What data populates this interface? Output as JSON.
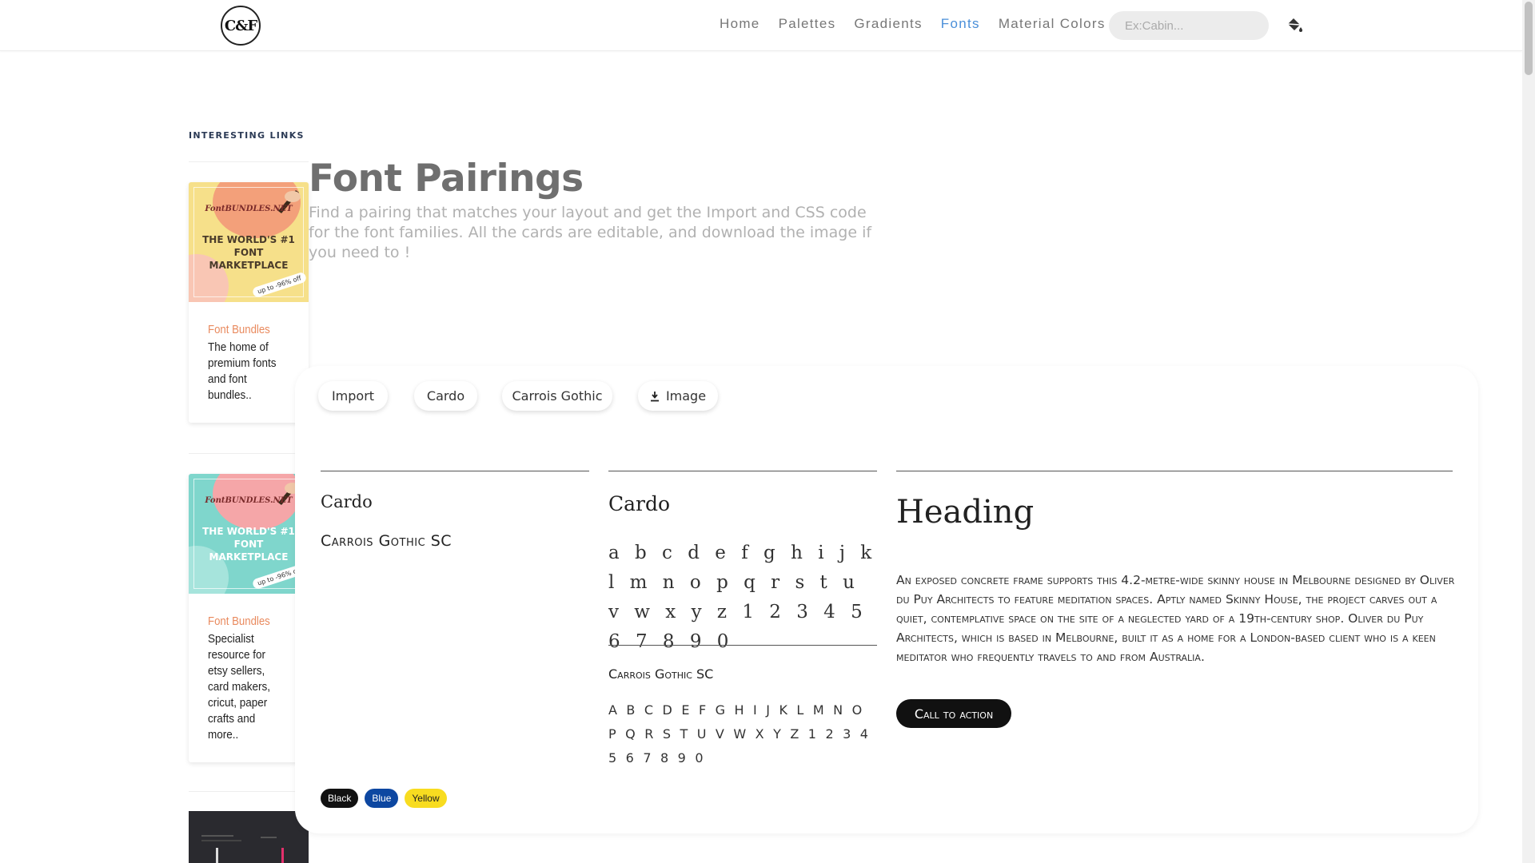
{
  "brand": {
    "logo_text": "C&F"
  },
  "nav": {
    "items": [
      {
        "label": "Home",
        "active": false
      },
      {
        "label": "Palettes",
        "active": false
      },
      {
        "label": "Gradients",
        "active": false
      },
      {
        "label": "Fonts",
        "active": true
      },
      {
        "label": "Material Colors",
        "active": false
      }
    ],
    "search_placeholder": "Ex:Cabin..."
  },
  "sidebar": {
    "title": "INTERESTING LINKS",
    "ads": [
      {
        "brand": "FontBUNDLES.NET",
        "headline": "THE WORLD'S #1 FONT MARKETPLACE",
        "tag": "up to -96% off",
        "link": "Font Bundles",
        "description": "The home of premium fonts and font bundles..",
        "bg": "#f6e08a",
        "accent": "#f3a07a"
      },
      {
        "brand": "FontBUNDLES.NET",
        "headline": "THE WORLD'S #1 FONT MARKETPLACE",
        "tag": "up to -96% off",
        "link": "Font Bundles",
        "description": "Specialist resource for etsy sellers, card makers, cricut, paper crafts and more..",
        "bg": "#7fd6cc",
        "accent": "#f5a6a8"
      }
    ]
  },
  "hero": {
    "title": "Font Pairings",
    "subtitle": "Find a pairing that matches your layout and get the Import and CSS code for the font families. All the cards are editable, and download the image if you need to !"
  },
  "card": {
    "buttons": {
      "import": "Import",
      "font1": "Cardo",
      "font2": "Carrois Gothic",
      "image": "Image"
    },
    "col1": {
      "font1": "Cardo",
      "font2": "Carrois Gothic SC"
    },
    "col2": {
      "font1": "Cardo",
      "lower": "a b c d e f g h i j k l m n o p q r s t u v w x y z 1 2 3 4 5 6 7 8 9 0",
      "font2": "Carrois Gothic SC",
      "upper": "A B C D E F G H I J K L M N O P Q R S T U V W X Y Z 1 2 3 4 5 6 7 8 9 0"
    },
    "col3": {
      "heading": "Heading",
      "body": "An exposed concrete frame supports this 4.2-metre-wide skinny house in Melbourne designed by Oliver du Puy Architects to feature meditation spaces. Aptly named Skinny House, the project carves out a quiet, contemplative space on the site of a neglected yard of a 19th-century shop. Oliver du Puy Architects, which is based in Melbourne, built it as a home for a London-based client who is a keen meditator who frequently travels to and from Australia.",
      "cta": "Call to action"
    },
    "tags": [
      {
        "label": "Black",
        "color": "#111111"
      },
      {
        "label": "Blue",
        "color": "#0d47a1"
      },
      {
        "label": "Yellow",
        "color": "#f8dc20"
      }
    ]
  },
  "colors": {
    "accent": "#4a8fd9",
    "link_orange": "#e98a5e"
  }
}
